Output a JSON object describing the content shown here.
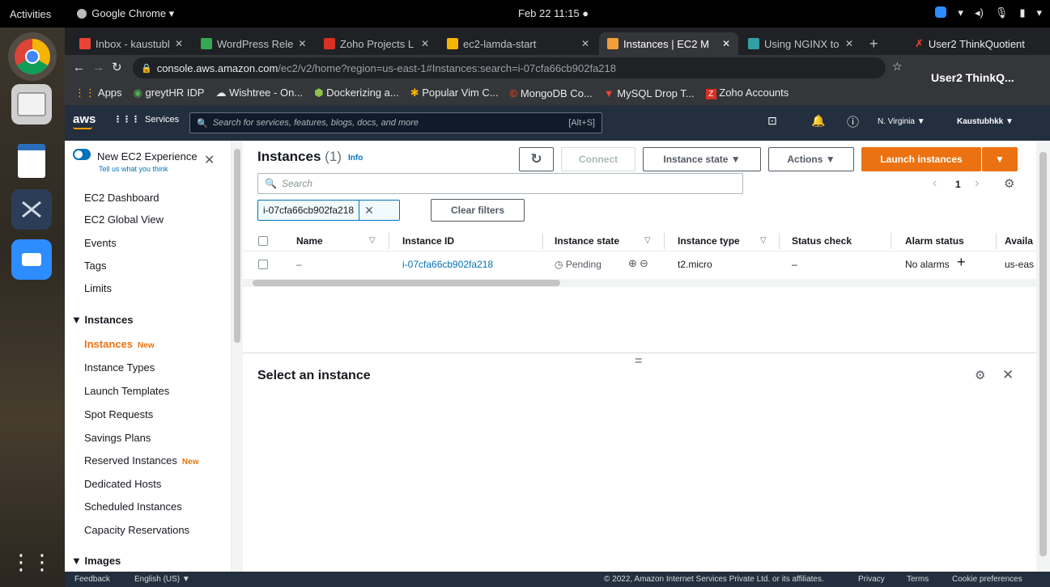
{
  "system": {
    "activities": "Activities",
    "app_menu": "Google Chrome ▾",
    "clock": "Feb 22 11:15 ●"
  },
  "browser": {
    "tabs": [
      {
        "label": "Inbox - kaustubl",
        "color": "#ea4335"
      },
      {
        "label": "WordPress Rele",
        "color": "#34a853"
      },
      {
        "label": "Zoho Projects L",
        "color": "#d93025"
      },
      {
        "label": "ec2-lamda-start",
        "color": "#f4b400"
      },
      {
        "label": "Instances | EC2 M",
        "color": "#f29d38"
      },
      {
        "label": "Using NGINX to",
        "color": "#34a0a4"
      }
    ],
    "new_tab": "+",
    "profile_tab": "User2 ThinkQuotient",
    "profile_name": "User2 ThinkQ...",
    "url_host": "console.aws.amazon.com",
    "url_path": "/ec2/v2/home?region=us-east-1#Instances:search=i-07cfa66cb902fa218",
    "bookmarks": [
      "Apps",
      "greytHR IDP",
      "Wishtree - On...",
      "Dockerizing a...",
      "Popular Vim C...",
      "MongoDB Co...",
      "MySQL Drop T...",
      "Zoho Accounts"
    ]
  },
  "aws": {
    "logo": "aws",
    "services": "Services",
    "search_placeholder": "Search for services, features, blogs, docs, and more",
    "shortcut": "[Alt+S]",
    "region": "N. Virginia ▼",
    "account": "Kaustubhkk ▼"
  },
  "sidebar": {
    "toggle_label": "New EC2 Experience",
    "toggle_sub": "Tell us what you think",
    "items_top": [
      "EC2 Dashboard",
      "EC2 Global View",
      "Events",
      "Tags",
      "Limits"
    ],
    "section_instances": "▼ Instances",
    "instances_items": [
      "Instances",
      "Instance Types",
      "Launch Templates",
      "Spot Requests",
      "Savings Plans",
      "Reserved Instances",
      "Dedicated Hosts",
      "Scheduled Instances",
      "Capacity Reservations"
    ],
    "new_badge": "New",
    "section_images": "▼ Images"
  },
  "main": {
    "title": "Instances",
    "count": "(1)",
    "info": "Info",
    "connect": "Connect",
    "instance_state": "Instance state ▼",
    "actions": "Actions ▼",
    "launch": "Launch instances",
    "launch_caret": "▼",
    "search_placeholder": "Search",
    "filter_token": "i-07cfa66cb902fa218",
    "clear_filters": "Clear filters",
    "page": "1",
    "columns": [
      "Name",
      "Instance ID",
      "Instance state",
      "Instance type",
      "Status check",
      "Alarm status",
      "Availa"
    ],
    "row": {
      "name": "–",
      "id": "i-07cfa66cb902fa218",
      "state": "Pending",
      "type": "t2.micro",
      "status": "–",
      "alarm": "No alarms",
      "az": "us-eas"
    }
  },
  "detail": {
    "title": "Select an instance",
    "drag": "="
  },
  "footer": {
    "feedback": "Feedback",
    "language": "English (US) ▼",
    "copyright": "© 2022, Amazon Internet Services Private Ltd. or its affiliates.",
    "privacy": "Privacy",
    "terms": "Terms",
    "cookies": "Cookie preferences"
  },
  "colors": {
    "aws_orange": "#ec7211",
    "aws_nav": "#232f3e",
    "link": "#0073bb"
  }
}
